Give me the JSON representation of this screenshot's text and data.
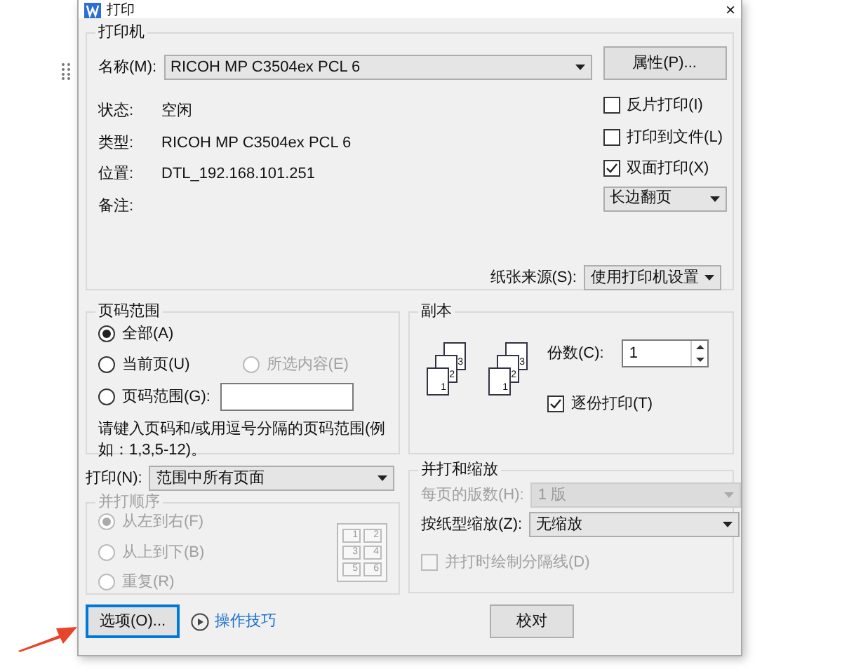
{
  "window": {
    "title": "打印",
    "close": "×"
  },
  "printer": {
    "legend": "打印机",
    "name_label": "名称(M):",
    "name": "RICOH MP C3504ex PCL 6",
    "properties_button": "属性(P)...",
    "info": [
      {
        "label": "状态:",
        "value": "空闲"
      },
      {
        "label": "类型:",
        "value": "RICOH MP C3504ex PCL 6"
      },
      {
        "label": "位置:",
        "value": "DTL_192.168.101.251"
      },
      {
        "label": "备注:"
      }
    ],
    "options": [
      {
        "label": "反片打印(I)",
        "checked": false
      },
      {
        "label": "打印到文件(L)",
        "checked": false
      },
      {
        "label": "双面打印(X)",
        "checked": true
      }
    ],
    "duplex_mode": "长边翻页",
    "paper_source_label": "纸张来源(S):",
    "paper_source": "使用打印机设置"
  },
  "page_range": {
    "legend": "页码范围",
    "options": [
      {
        "label": "全部(A)",
        "selected": true,
        "disabled": false,
        "kind": "plain"
      },
      {
        "label": "当前页(U)",
        "selected": false,
        "disabled": false,
        "kind": "plain"
      },
      {
        "label": "所选内容(E)",
        "selected": false,
        "disabled": true,
        "kind": "plain"
      },
      {
        "label": "页码范围(G):",
        "selected": false,
        "disabled": false,
        "kind": "field"
      }
    ],
    "hint": "请键入页码和/或用逗号分隔的页码范围(例如：1,3,5-12)。"
  },
  "copies": {
    "legend": "副本",
    "stacks": [
      [
        "3",
        "2",
        "1"
      ],
      [
        "3",
        "2",
        "1"
      ]
    ],
    "count_label": "份数(C):",
    "count": "1",
    "collate_label": "逐份打印(T)",
    "collate": true
  },
  "print_what": {
    "label": "打印(N):",
    "value": "范围中所有页面"
  },
  "order": {
    "legend": "并打顺序",
    "disabled": true,
    "options": [
      {
        "label": "从左到右(F)",
        "selected": true
      },
      {
        "label": "从上到下(B)",
        "selected": false
      },
      {
        "label": "重复(R)",
        "selected": false
      }
    ],
    "grid": [
      "1",
      "2",
      "3",
      "4",
      "5",
      "6"
    ]
  },
  "zoom": {
    "legend": "并打和缩放",
    "pages_label": "每页的版数(H):",
    "pages": "1 版",
    "pages_disabled": true,
    "scale_label": "按纸型缩放(Z):",
    "scale": "无缩放",
    "divider_label": "并打时绘制分隔线(D)",
    "divider_checked": false,
    "divider_disabled": true
  },
  "buttons": {
    "options": "选项(O)...",
    "tips": "操作技巧",
    "proofread": "校对"
  }
}
